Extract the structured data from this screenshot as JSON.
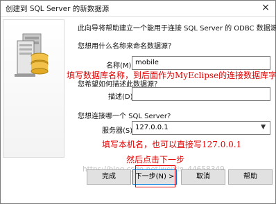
{
  "window": {
    "title": "创建到 SQL Server 的新数据源",
    "close_glyph": "×"
  },
  "intro": "此向导将帮助建立一个能用于连接 SQL Server 的 ODBC 数据源。",
  "name_prompt": "您想用什么名称来命名数据源？",
  "name_label": "名称(M):",
  "name_value": "mobile",
  "desc_prompt": "您希望如何描述此数据源？",
  "desc_label": "描述(D):",
  "desc_value": "",
  "server_prompt": "您想连接哪一个 SQL Server?",
  "server_label": "服务器(S):",
  "server_value": "127.0.0.1",
  "annotations": {
    "name_note": "填写数据库名称，到后面作为MyEclipse的连接数据库字段",
    "server_note": "填写本机名，也可以直接写127.0.0.1",
    "next_note": "然后点击下一步"
  },
  "buttons": {
    "finish": "完成",
    "next": "下一步(N) >",
    "cancel": "取消",
    "help": "帮助"
  },
  "watermark": "https://blog.csdn.net/weixin_44658349",
  "colors": {
    "annotation": "#e00000",
    "accent": "#0078d7"
  }
}
